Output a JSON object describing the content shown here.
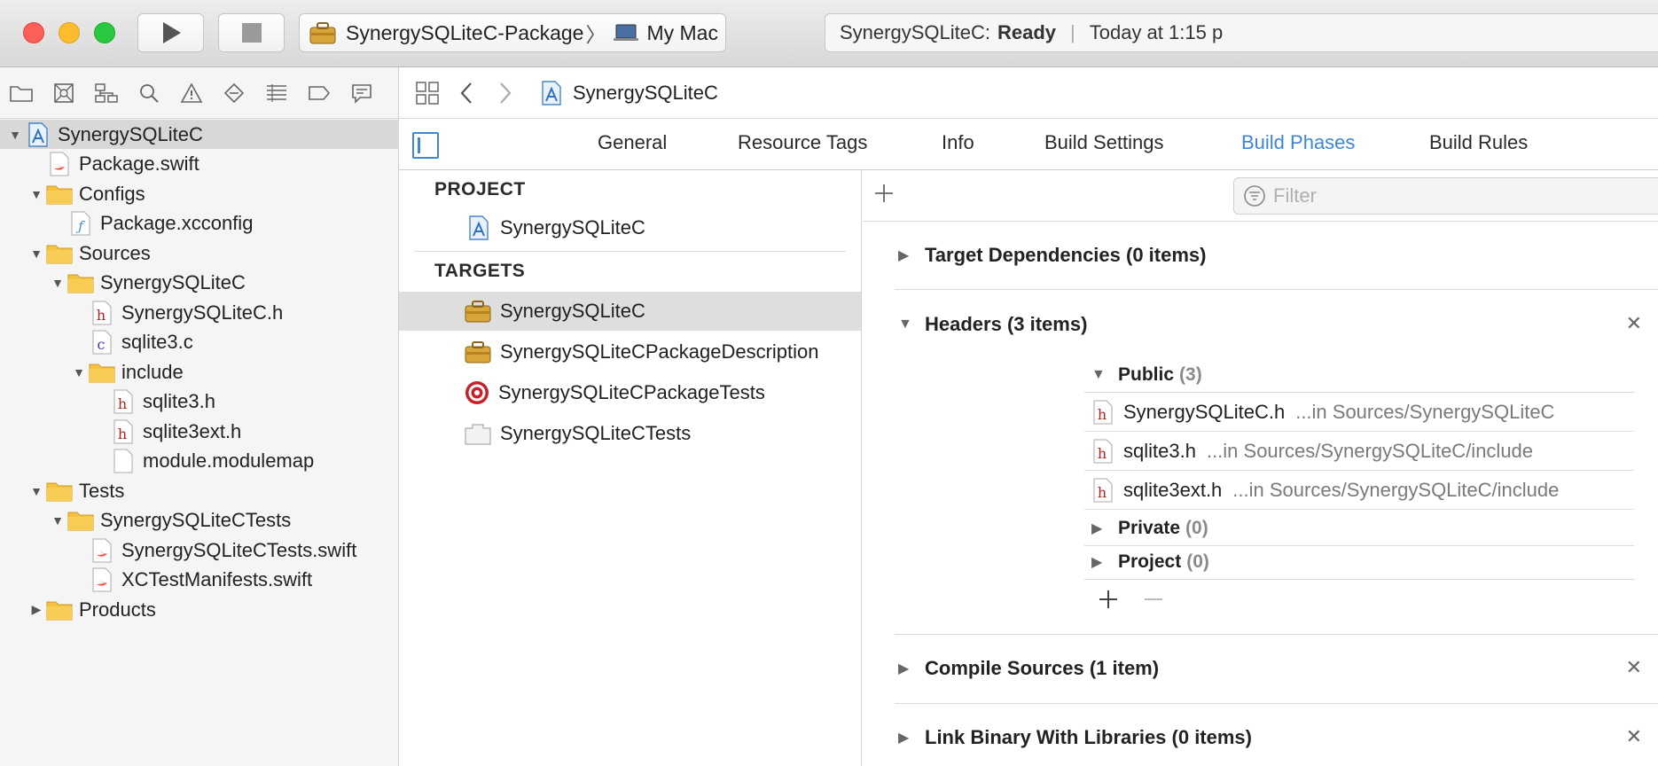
{
  "toolbar": {
    "scheme_project": "SynergySQLiteC-Package",
    "scheme_separator": "〉",
    "scheme_destination": "My Mac",
    "activity_target": "SynergySQLiteC:",
    "activity_status": "Ready",
    "activity_time": "Today at 1:15 p",
    "colors": {
      "close": "#fc5f57",
      "minimize": "#fdbc2e",
      "zoom": "#28c840"
    }
  },
  "navigator": {
    "icons": [
      "folder-icon",
      "source-control-icon",
      "symbol-icon",
      "find-icon",
      "issue-icon",
      "test-icon",
      "debug-icon",
      "breakpoint-icon",
      "report-icon"
    ],
    "items": [
      {
        "label": "SynergySQLiteC",
        "icon": "project-icon",
        "disclosure": "open",
        "selected": true
      },
      {
        "label": "Package.swift",
        "icon": "swift-file-icon"
      },
      {
        "label": "Configs",
        "icon": "folder-icon",
        "disclosure": "open"
      },
      {
        "label": "Package.xcconfig",
        "icon": "xcconfig-file-icon"
      },
      {
        "label": "Sources",
        "icon": "folder-icon",
        "disclosure": "open"
      },
      {
        "label": "SynergySQLiteC",
        "icon": "folder-icon",
        "disclosure": "open"
      },
      {
        "label": "SynergySQLiteC.h",
        "icon": "header-file-icon"
      },
      {
        "label": "sqlite3.c",
        "icon": "c-file-icon"
      },
      {
        "label": "include",
        "icon": "folder-icon",
        "disclosure": "open"
      },
      {
        "label": "sqlite3.h",
        "icon": "header-file-icon"
      },
      {
        "label": "sqlite3ext.h",
        "icon": "header-file-icon"
      },
      {
        "label": "module.modulemap",
        "icon": "blank-file-icon"
      },
      {
        "label": "Tests",
        "icon": "folder-icon",
        "disclosure": "open"
      },
      {
        "label": "SynergySQLiteCTests",
        "icon": "folder-icon",
        "disclosure": "open"
      },
      {
        "label": "SynergySQLiteCTests.swift",
        "icon": "swift-file-icon"
      },
      {
        "label": "XCTestManifests.swift",
        "icon": "swift-file-icon"
      },
      {
        "label": "Products",
        "icon": "folder-icon",
        "disclosure": "closed"
      }
    ]
  },
  "jumpbar": {
    "crumb": "SynergySQLiteC"
  },
  "tabs": {
    "general": "General",
    "resource_tags": "Resource Tags",
    "info": "Info",
    "build_settings": "Build Settings",
    "build_phases": "Build Phases",
    "build_rules": "Build Rules",
    "active": "Build Phases",
    "active_color": "#3e86d4"
  },
  "targets_list": {
    "project_heading": "PROJECT",
    "project_item": "SynergySQLiteC",
    "targets_heading": "TARGETS",
    "targets": [
      {
        "label": "SynergySQLiteC",
        "icon": "framework-target-icon",
        "selected": true
      },
      {
        "label": "SynergySQLiteCPackageDescription",
        "icon": "framework-target-icon"
      },
      {
        "label": "SynergySQLiteCPackageTests",
        "icon": "test-target-icon"
      },
      {
        "label": "SynergySQLiteCTests",
        "icon": "blank-target-icon"
      }
    ]
  },
  "phases": {
    "filter_placeholder": "Filter",
    "target_dependencies": "Target Dependencies (0 items)",
    "headers": "Headers (3 items)",
    "public_label": "Public",
    "public_count": "(3)",
    "header_files": [
      {
        "name": "SynergySQLiteC.h",
        "path": "...in Sources/SynergySQLiteC"
      },
      {
        "name": "sqlite3.h",
        "path": "...in Sources/SynergySQLiteC/include"
      },
      {
        "name": "sqlite3ext.h",
        "path": "...in Sources/SynergySQLiteC/include"
      }
    ],
    "private_label": "Private",
    "private_count": "(0)",
    "project_label": "Project",
    "project_count": "(0)",
    "compile_sources": "Compile Sources (1 item)",
    "link_binary": "Link Binary With Libraries (0 items)"
  }
}
